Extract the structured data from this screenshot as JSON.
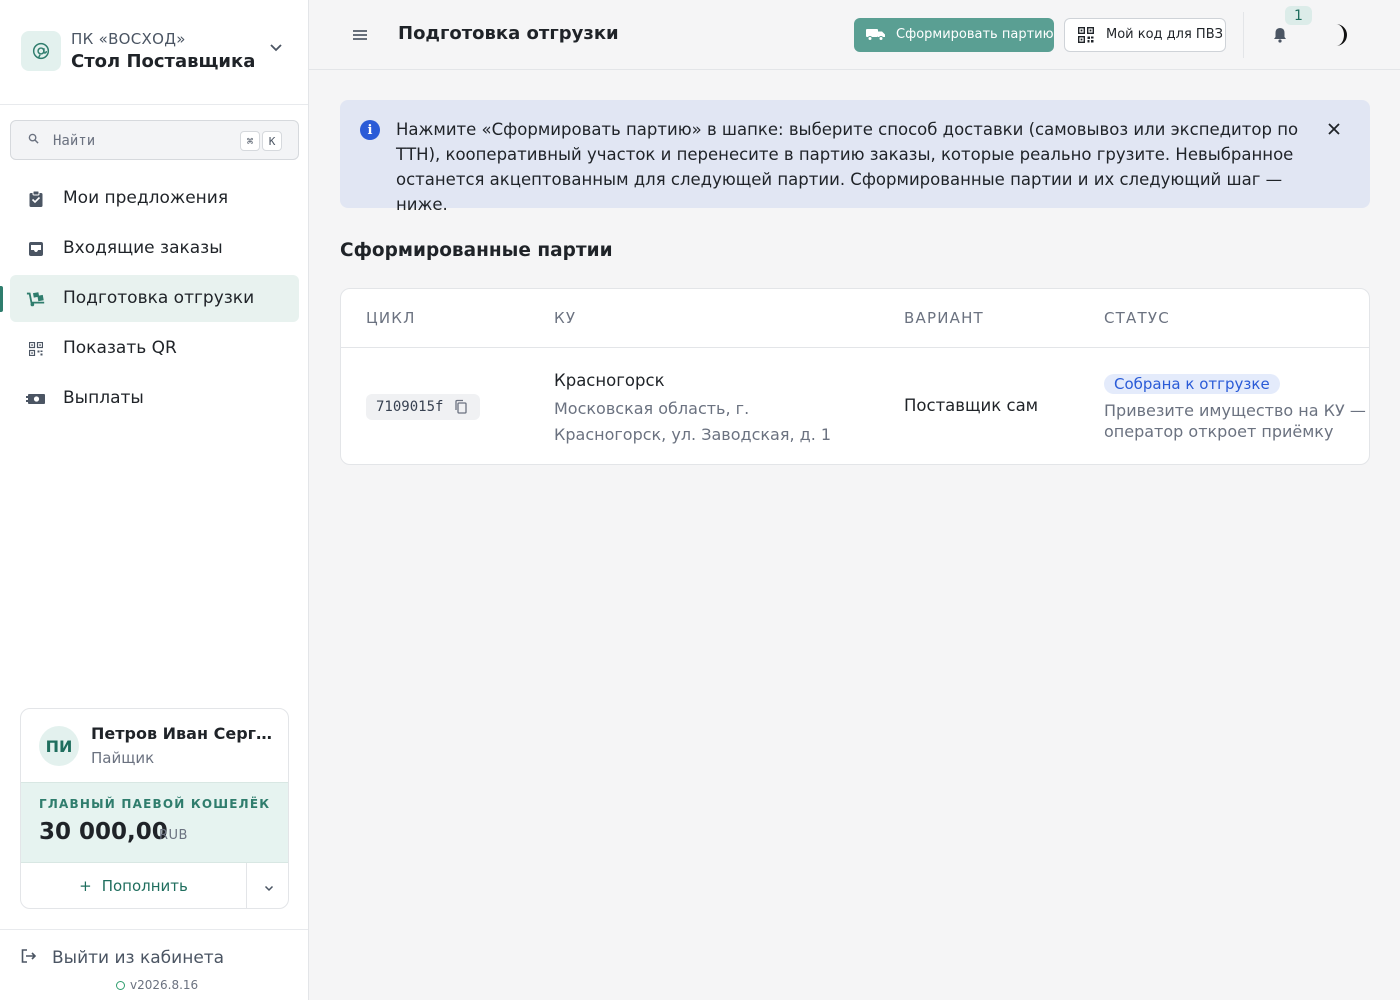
{
  "brand": {
    "org": "ПК «ВОСХОД»",
    "name": "Стол Поставщика",
    "logo_icon": "leaf-at-icon"
  },
  "search": {
    "placeholder": "Найти",
    "shortcut_mod": "⌘",
    "shortcut_key": "K"
  },
  "sidebar": {
    "items": [
      {
        "label": "Мои предложения",
        "icon": "clipboard-icon",
        "active": false
      },
      {
        "label": "Входящие заказы",
        "icon": "inbox-icon",
        "active": false
      },
      {
        "label": "Подготовка отгрузки",
        "icon": "dolly-icon",
        "active": true
      },
      {
        "label": "Показать QR",
        "icon": "qr-icon",
        "active": false
      },
      {
        "label": "Выплаты",
        "icon": "money-icon",
        "active": false
      }
    ]
  },
  "user": {
    "initials": "ПИ",
    "name": "Петров Иван Сергеевич",
    "role": "Пайщик",
    "wallet_label": "ГЛАВНЫЙ ПАЕВОЙ КОШЕЛЁК",
    "wallet_amount": "30 000,00",
    "wallet_currency": "RUB",
    "topup_label": "Пополнить"
  },
  "footer": {
    "logout_label": "Выйти из кабинета",
    "version": "v2026.8.16"
  },
  "header": {
    "title": "Подготовка отгрузки",
    "primary_button": "Сформировать партию",
    "secondary_button": "Мой код для ПВЗ",
    "notifications_count": "1"
  },
  "alert": {
    "text": "Нажмите «Сформировать партию» в шапке: выберите способ доставки (самовывоз или экспедитор по ТТН), кооперативный участок и перенесите в партию заказы, которые реально грузите. Невыбранное останется акцептованным для следующей партии. Сформированные партии и их следующий шаг — ниже."
  },
  "batches": {
    "title": "Сформированные партии",
    "columns": [
      "ЦИКЛ",
      "КУ",
      "ВАРИАНТ",
      "СТАТУС"
    ],
    "rows": [
      {
        "cycle": "7109015f",
        "ku_name": "Красногорск",
        "ku_address": "Московская область, г. Красногорск, ул. Заводская, д. 1",
        "variant": "Поставщик сам",
        "status": "Собрана к отгрузке",
        "status_hint": "Привезите имущество на КУ — оператор откроет приёмку"
      }
    ]
  },
  "colors": {
    "accent": "#2f7d6d",
    "primary_button": "#5a9f93",
    "alert_bg": "#e1e6f3",
    "info_blue": "#2a5bd7"
  }
}
